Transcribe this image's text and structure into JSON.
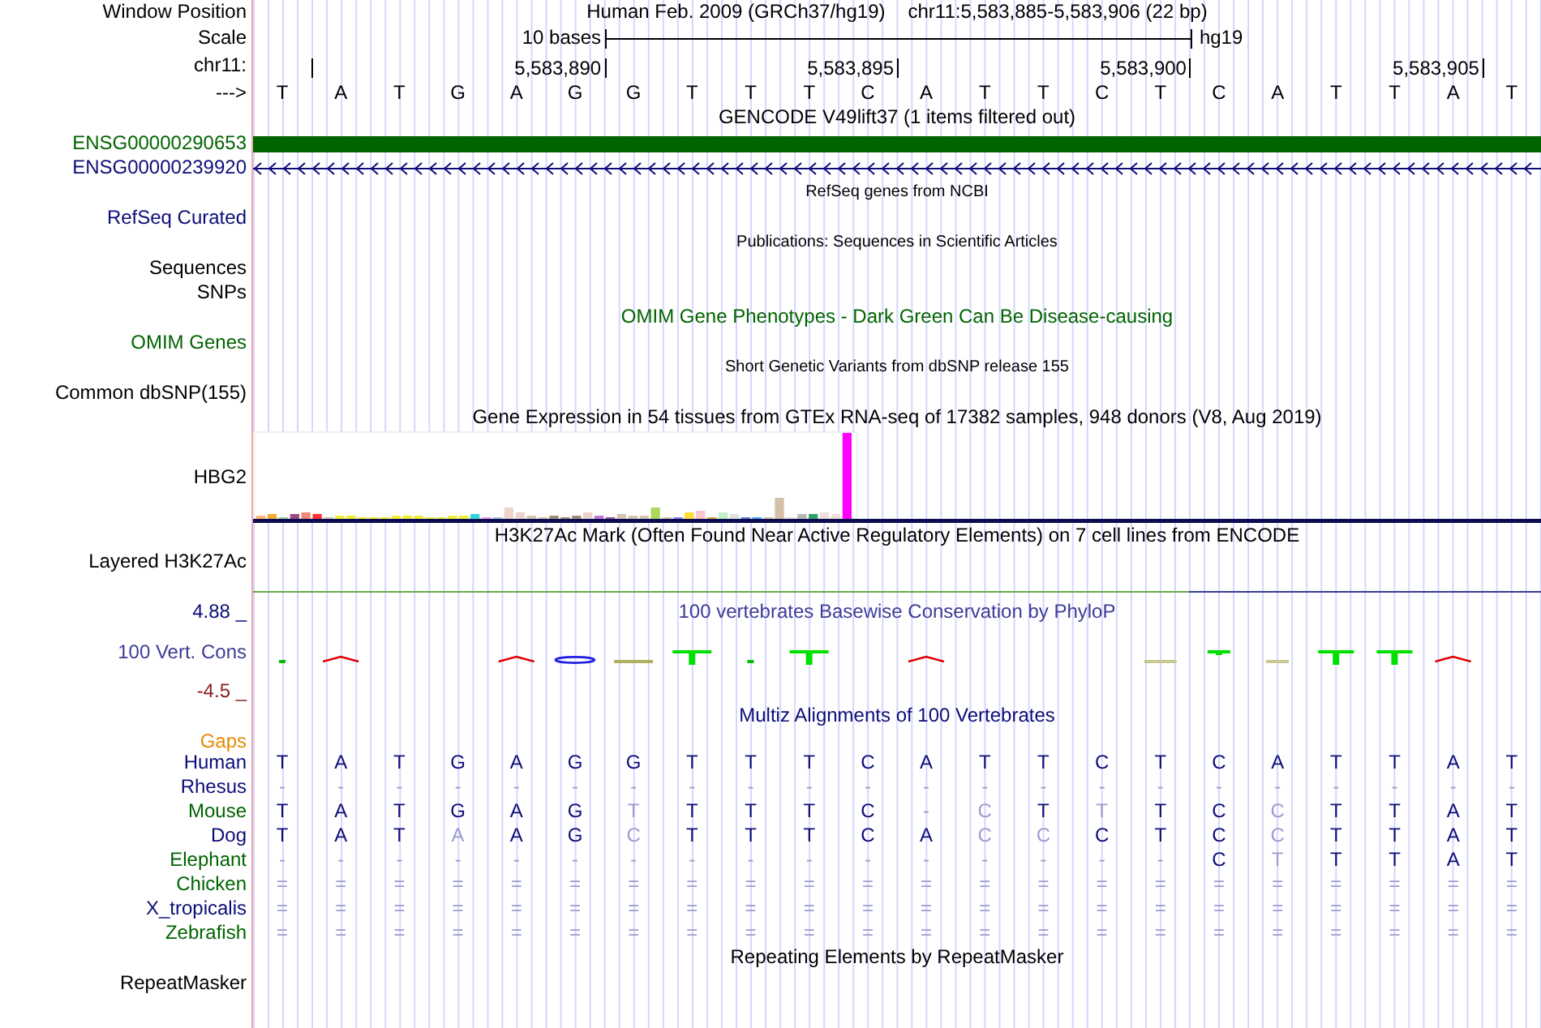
{
  "ruler": {
    "position_label": "Window Position",
    "assembly": "Human Feb. 2009 (GRCh37/hg19)",
    "position": "chr11:5,583,885-5,583,906 (22 bp)",
    "scale_label": "Scale",
    "scale_text": "10 bases",
    "scale_db": "hg19",
    "chrom_label": "chr11:",
    "ticks": [
      {
        "kind": "minor"
      },
      {
        "kind": "major",
        "label": "5,583,890"
      },
      {
        "kind": "major",
        "label": "5,583,895"
      },
      {
        "kind": "major",
        "label": "5,583,900"
      },
      {
        "kind": "major",
        "label": "5,583,905"
      }
    ],
    "strand_label": "--->",
    "bases": [
      "T",
      "A",
      "T",
      "G",
      "A",
      "G",
      "G",
      "T",
      "T",
      "T",
      "C",
      "A",
      "T",
      "T",
      "C",
      "T",
      "C",
      "A",
      "T",
      "T",
      "A",
      "T"
    ]
  },
  "tracks": [
    {
      "kind": "title",
      "title": "GENCODE V49lift37 (1 items filtered out)",
      "color": "#000000"
    },
    {
      "kind": "block",
      "label": "ENSG00000290653",
      "color": "#006400"
    },
    {
      "kind": "strand",
      "label": "ENSG00000239920",
      "color": "#0c0c78"
    },
    {
      "kind": "note",
      "title": "RefSeq genes from NCBI",
      "color": "#000000"
    },
    {
      "kind": "label",
      "label": "RefSeq Curated",
      "color": "#0c0c78"
    },
    {
      "kind": "note",
      "title": "Publications: Sequences in Scientific Articles",
      "color": "#000000"
    },
    {
      "kind": "label",
      "label": "Sequences",
      "color": "#000000"
    },
    {
      "kind": "label",
      "label": "SNPs",
      "color": "#000000"
    },
    {
      "kind": "title",
      "title": "OMIM Gene Phenotypes - Dark Green Can Be Disease-causing",
      "color": "#006400"
    },
    {
      "kind": "label",
      "label": "OMIM Genes",
      "color": "#006400"
    },
    {
      "kind": "note",
      "title": "Short Genetic Variants from dbSNP release 155",
      "color": "#000000"
    },
    {
      "kind": "label",
      "label": "Common dbSNP(155)",
      "color": "#000000"
    },
    {
      "kind": "title",
      "title": "Gene Expression in 54 tissues from GTEx RNA-seq of 17382 samples, 948 donors (V8, Aug 2019)",
      "color": "#000000"
    },
    {
      "kind": "expression",
      "label": "HBG2",
      "color": "#000000"
    },
    {
      "kind": "title",
      "title": "H3K27Ac Mark (Often Found Near Active Regulatory Elements) on 7 cell lines from ENCODE",
      "color": "#000000"
    },
    {
      "kind": "layered",
      "label": "Layered H3K27Ac",
      "color": "#000000"
    },
    {
      "kind": "conservation",
      "title": "100 vertebrates Basewise Conservation by PhyloP",
      "label": "100 Vert. Cons",
      "max": "4.88 _",
      "min": "-4.5 _",
      "color": "#3c3c96"
    },
    {
      "kind": "title",
      "title": "Multiz Alignments of 100 Vertebrates",
      "color": "#0c0c78"
    },
    {
      "kind": "gaps",
      "label": "Gaps",
      "color": "#e68a00"
    },
    {
      "kind": "alignment",
      "label": "Human",
      "color": "#0c0c78",
      "bases": [
        {
          "base": "T",
          "faded": false
        },
        {
          "base": "A",
          "faded": false
        },
        {
          "base": "T",
          "faded": false
        },
        {
          "base": "G",
          "faded": false
        },
        {
          "base": "A",
          "faded": false
        },
        {
          "base": "G",
          "faded": false
        },
        {
          "base": "G",
          "faded": false
        },
        {
          "base": "T",
          "faded": false
        },
        {
          "base": "T",
          "faded": false
        },
        {
          "base": "T",
          "faded": false
        },
        {
          "base": "C",
          "faded": false
        },
        {
          "base": "A",
          "faded": false
        },
        {
          "base": "T",
          "faded": false
        },
        {
          "base": "T",
          "faded": false
        },
        {
          "base": "C",
          "faded": false
        },
        {
          "base": "T",
          "faded": false
        },
        {
          "base": "C",
          "faded": false
        },
        {
          "base": "A",
          "faded": false
        },
        {
          "base": "T",
          "faded": false
        },
        {
          "base": "T",
          "faded": false
        },
        {
          "base": "A",
          "faded": false
        },
        {
          "base": "T",
          "faded": false
        }
      ]
    },
    {
      "kind": "alignment",
      "label": "Rhesus",
      "color": "#0c0c78",
      "bases": [
        {
          "base": "-",
          "faded": true
        },
        {
          "base": "-",
          "faded": true
        },
        {
          "base": "-",
          "faded": true
        },
        {
          "base": "-",
          "faded": true
        },
        {
          "base": "-",
          "faded": true
        },
        {
          "base": "-",
          "faded": true
        },
        {
          "base": "-",
          "faded": true
        },
        {
          "base": "-",
          "faded": true
        },
        {
          "base": "-",
          "faded": true
        },
        {
          "base": "-",
          "faded": true
        },
        {
          "base": "-",
          "faded": true
        },
        {
          "base": "-",
          "faded": true
        },
        {
          "base": "-",
          "faded": true
        },
        {
          "base": "-",
          "faded": true
        },
        {
          "base": "-",
          "faded": true
        },
        {
          "base": "-",
          "faded": true
        },
        {
          "base": "-",
          "faded": true
        },
        {
          "base": "-",
          "faded": true
        },
        {
          "base": "-",
          "faded": true
        },
        {
          "base": "-",
          "faded": true
        },
        {
          "base": "-",
          "faded": true
        },
        {
          "base": "-",
          "faded": true
        }
      ]
    },
    {
      "kind": "alignment",
      "label": "Mouse",
      "color": "#006400",
      "bases": [
        {
          "base": "T",
          "faded": false
        },
        {
          "base": "A",
          "faded": false
        },
        {
          "base": "T",
          "faded": false
        },
        {
          "base": "G",
          "faded": false
        },
        {
          "base": "A",
          "faded": false
        },
        {
          "base": "G",
          "faded": false
        },
        {
          "base": "T",
          "faded": true
        },
        {
          "base": "T",
          "faded": false
        },
        {
          "base": "T",
          "faded": false
        },
        {
          "base": "T",
          "faded": false
        },
        {
          "base": "C",
          "faded": false
        },
        {
          "base": "-",
          "faded": true
        },
        {
          "base": "C",
          "faded": true
        },
        {
          "base": "T",
          "faded": false
        },
        {
          "base": "T",
          "faded": true
        },
        {
          "base": "T",
          "faded": false
        },
        {
          "base": "C",
          "faded": false
        },
        {
          "base": "C",
          "faded": true
        },
        {
          "base": "T",
          "faded": false
        },
        {
          "base": "T",
          "faded": false
        },
        {
          "base": "A",
          "faded": false
        },
        {
          "base": "T",
          "faded": false
        }
      ]
    },
    {
      "kind": "alignment",
      "label": "Dog",
      "color": "#0c0c78",
      "bases": [
        {
          "base": "T",
          "faded": false
        },
        {
          "base": "A",
          "faded": false
        },
        {
          "base": "T",
          "faded": false
        },
        {
          "base": "A",
          "faded": true
        },
        {
          "base": "A",
          "faded": false
        },
        {
          "base": "G",
          "faded": false
        },
        {
          "base": "C",
          "faded": true
        },
        {
          "base": "T",
          "faded": false
        },
        {
          "base": "T",
          "faded": false
        },
        {
          "base": "T",
          "faded": false
        },
        {
          "base": "C",
          "faded": false
        },
        {
          "base": "A",
          "faded": false
        },
        {
          "base": "C",
          "faded": true
        },
        {
          "base": "C",
          "faded": true
        },
        {
          "base": "C",
          "faded": false
        },
        {
          "base": "T",
          "faded": false
        },
        {
          "base": "C",
          "faded": false
        },
        {
          "base": "C",
          "faded": true
        },
        {
          "base": "T",
          "faded": false
        },
        {
          "base": "T",
          "faded": false
        },
        {
          "base": "A",
          "faded": false
        },
        {
          "base": "T",
          "faded": false
        }
      ]
    },
    {
      "kind": "alignment",
      "label": "Elephant",
      "color": "#006400",
      "bases": [
        {
          "base": "-",
          "faded": true
        },
        {
          "base": "-",
          "faded": true
        },
        {
          "base": "-",
          "faded": true
        },
        {
          "base": "-",
          "faded": true
        },
        {
          "base": "-",
          "faded": true
        },
        {
          "base": "-",
          "faded": true
        },
        {
          "base": "-",
          "faded": true
        },
        {
          "base": "-",
          "faded": true
        },
        {
          "base": "-",
          "faded": true
        },
        {
          "base": "-",
          "faded": true
        },
        {
          "base": "-",
          "faded": true
        },
        {
          "base": "-",
          "faded": true
        },
        {
          "base": "-",
          "faded": true
        },
        {
          "base": "-",
          "faded": true
        },
        {
          "base": "-",
          "faded": true
        },
        {
          "base": "-",
          "faded": true
        },
        {
          "base": "C",
          "faded": false
        },
        {
          "base": "T",
          "faded": true
        },
        {
          "base": "T",
          "faded": false
        },
        {
          "base": "T",
          "faded": false
        },
        {
          "base": "A",
          "faded": false
        },
        {
          "base": "T",
          "faded": false
        }
      ]
    },
    {
      "kind": "alignment",
      "label": "Chicken",
      "color": "#006400",
      "bases": [
        {
          "base": "=",
          "faded": true
        },
        {
          "base": "=",
          "faded": true
        },
        {
          "base": "=",
          "faded": true
        },
        {
          "base": "=",
          "faded": true
        },
        {
          "base": "=",
          "faded": true
        },
        {
          "base": "=",
          "faded": true
        },
        {
          "base": "=",
          "faded": true
        },
        {
          "base": "=",
          "faded": true
        },
        {
          "base": "=",
          "faded": true
        },
        {
          "base": "=",
          "faded": true
        },
        {
          "base": "=",
          "faded": true
        },
        {
          "base": "=",
          "faded": true
        },
        {
          "base": "=",
          "faded": true
        },
        {
          "base": "=",
          "faded": true
        },
        {
          "base": "=",
          "faded": true
        },
        {
          "base": "=",
          "faded": true
        },
        {
          "base": "=",
          "faded": true
        },
        {
          "base": "=",
          "faded": true
        },
        {
          "base": "=",
          "faded": true
        },
        {
          "base": "=",
          "faded": true
        },
        {
          "base": "=",
          "faded": true
        },
        {
          "base": "=",
          "faded": true
        }
      ]
    },
    {
      "kind": "alignment",
      "label": "X_tropicalis",
      "color": "#0c0c78",
      "bases": [
        {
          "base": "=",
          "faded": true
        },
        {
          "base": "=",
          "faded": true
        },
        {
          "base": "=",
          "faded": true
        },
        {
          "base": "=",
          "faded": true
        },
        {
          "base": "=",
          "faded": true
        },
        {
          "base": "=",
          "faded": true
        },
        {
          "base": "=",
          "faded": true
        },
        {
          "base": "=",
          "faded": true
        },
        {
          "base": "=",
          "faded": true
        },
        {
          "base": "=",
          "faded": true
        },
        {
          "base": "=",
          "faded": true
        },
        {
          "base": "=",
          "faded": true
        },
        {
          "base": "=",
          "faded": true
        },
        {
          "base": "=",
          "faded": true
        },
        {
          "base": "=",
          "faded": true
        },
        {
          "base": "=",
          "faded": true
        },
        {
          "base": "=",
          "faded": true
        },
        {
          "base": "=",
          "faded": true
        },
        {
          "base": "=",
          "faded": true
        },
        {
          "base": "=",
          "faded": true
        },
        {
          "base": "=",
          "faded": true
        },
        {
          "base": "=",
          "faded": true
        }
      ]
    },
    {
      "kind": "alignment",
      "label": "Zebrafish",
      "color": "#006400",
      "bases": [
        {
          "base": "=",
          "faded": true
        },
        {
          "base": "=",
          "faded": true
        },
        {
          "base": "=",
          "faded": true
        },
        {
          "base": "=",
          "faded": true
        },
        {
          "base": "=",
          "faded": true
        },
        {
          "base": "=",
          "faded": true
        },
        {
          "base": "=",
          "faded": true
        },
        {
          "base": "=",
          "faded": true
        },
        {
          "base": "=",
          "faded": true
        },
        {
          "base": "=",
          "faded": true
        },
        {
          "base": "=",
          "faded": true
        },
        {
          "base": "=",
          "faded": true
        },
        {
          "base": "=",
          "faded": true
        },
        {
          "base": "=",
          "faded": true
        },
        {
          "base": "=",
          "faded": true
        },
        {
          "base": "=",
          "faded": true
        },
        {
          "base": "=",
          "faded": true
        },
        {
          "base": "=",
          "faded": true
        },
        {
          "base": "=",
          "faded": true
        },
        {
          "base": "=",
          "faded": true
        },
        {
          "base": "=",
          "faded": true
        },
        {
          "base": "=",
          "faded": true
        }
      ]
    },
    {
      "kind": "title",
      "title": "Repeating Elements by RepeatMasker",
      "color": "#000000"
    },
    {
      "kind": "label",
      "label": "RepeatMasker",
      "color": "#000000"
    }
  ]
}
